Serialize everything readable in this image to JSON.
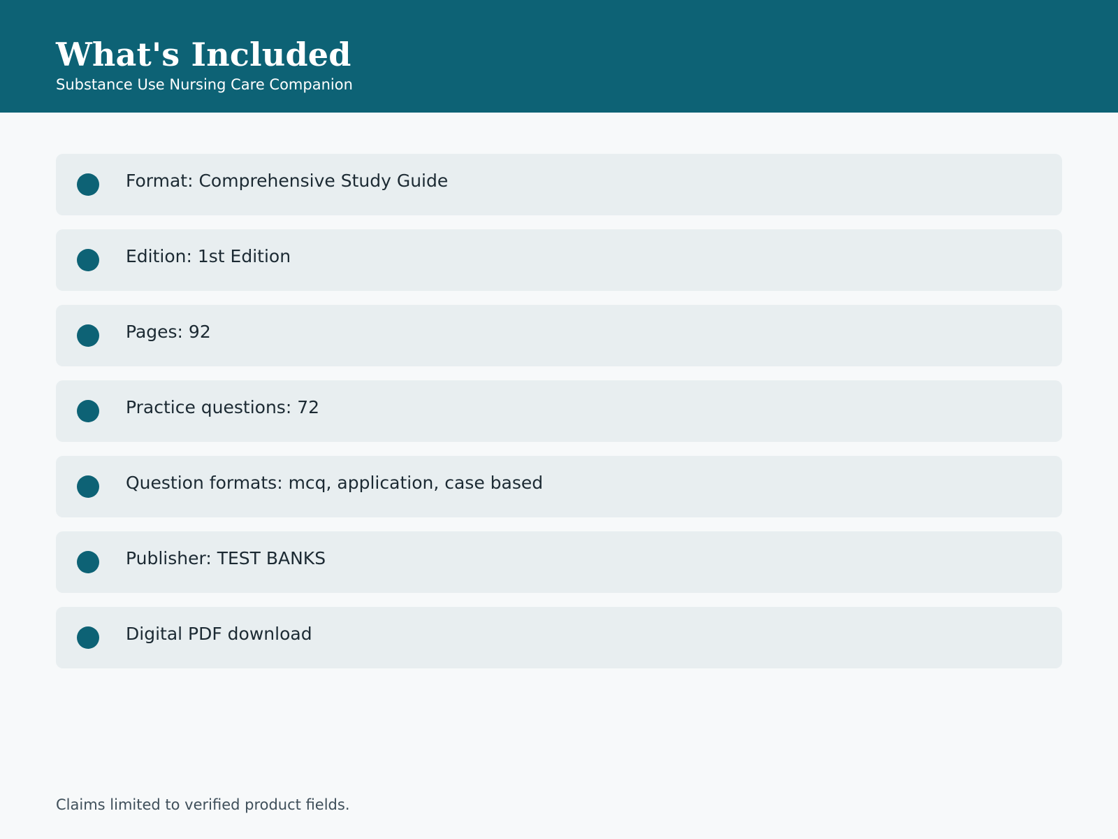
{
  "header": {
    "title": "What's Included",
    "subtitle": "Substance Use Nursing Care Companion"
  },
  "features": [
    {
      "label": "Format: Comprehensive Study Guide"
    },
    {
      "label": "Edition: 1st Edition"
    },
    {
      "label": "Pages: 92"
    },
    {
      "label": "Practice questions: 72"
    },
    {
      "label": "Question formats: mcq, application, case based"
    },
    {
      "label": "Publisher: TEST BANKS"
    },
    {
      "label": "Digital PDF download"
    }
  ],
  "footer": {
    "note": "Claims limited to verified product fields."
  },
  "colors": {
    "header_background": "#0d6275",
    "bullet": "#0d6275",
    "item_background": "#e8eef0",
    "page_background": "#f7f9fa"
  },
  "icons": {
    "bullet": "bullet-dot-icon"
  }
}
